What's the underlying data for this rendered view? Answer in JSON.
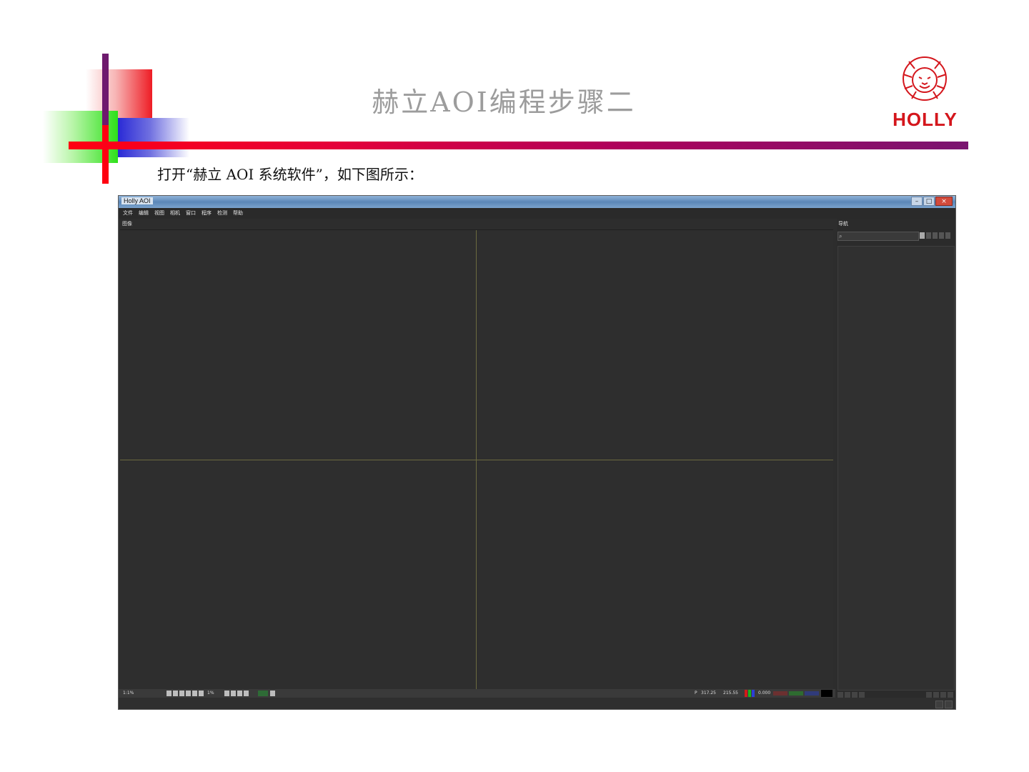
{
  "slide": {
    "title": "赫立AOI编程步骤二",
    "caption": "打开“赫立 AOI 系统软件”，如下图所示：",
    "logo_text": "HOLLY",
    "colors": {
      "accent_red": "#ff0012",
      "accent_purple": "#7a1470",
      "title_gray": "#9c9c9c",
      "logo_red": "#d4161c"
    }
  },
  "app": {
    "window_title": "Holly AOI",
    "window_controls": [
      "minimize-icon",
      "maximize-icon",
      "close-icon"
    ],
    "menu": [
      "文件",
      "编辑",
      "视图",
      "相机",
      "窗口",
      "程序",
      "检测",
      "帮助"
    ],
    "toolbar_label": "图像",
    "panel": {
      "title": "导航",
      "search_placeholder": "",
      "search_icon": "search-icon"
    },
    "status": {
      "zoom": "1:1%",
      "page": "1%",
      "coord_label": "P",
      "coord_x": "317.25",
      "coord_y": "215.55",
      "r_value": "0.000",
      "colors": {
        "r": "#d21a1a",
        "g": "#1bb31b",
        "b": "#2c3fd6"
      }
    },
    "viewport": {
      "background": "#2e2e2e",
      "crosshair_color": "#6b6a3f"
    }
  }
}
